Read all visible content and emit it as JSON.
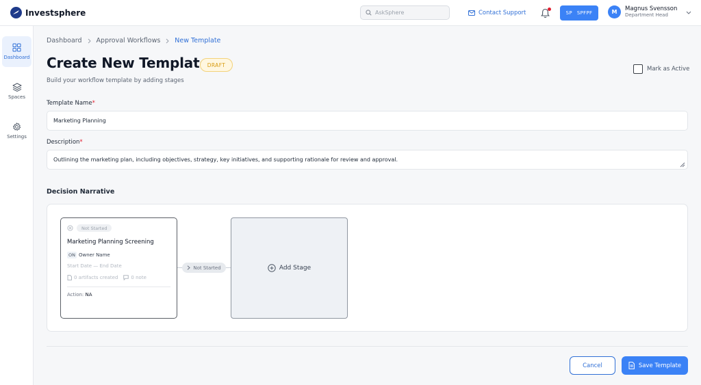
{
  "app": {
    "name": "Investsphere"
  },
  "header": {
    "search_placeholder": "AskSphere",
    "contact_label": "Contact Support",
    "space_initials": "SP",
    "space_name": "SPFPF",
    "user": {
      "initial": "M",
      "name": "Magnus Svensson",
      "role": "Department Head"
    }
  },
  "sidebar": {
    "items": [
      {
        "label": "Dashboard",
        "icon": "grid-icon",
        "active": true
      },
      {
        "label": "Spaces",
        "icon": "layers-icon",
        "active": false
      },
      {
        "label": "Settings",
        "icon": "gear-icon",
        "active": false
      }
    ]
  },
  "breadcrumb": {
    "items": [
      "Dashboard",
      "Approval Workflows",
      "New Template"
    ]
  },
  "page": {
    "title": "Create New Template",
    "badge": "DRAFT",
    "subtitle": "Build your workflow template by adding stages",
    "mark_active_label": "Mark as Active"
  },
  "form": {
    "template_name_label": "Template Name",
    "template_name_value": "Marketing Planning",
    "description_label": "Description",
    "description_value": "Outlining the marketing plan, including objectives, strategy, key initiatives, and supporting rationale for review and approval.",
    "required_mark": "*"
  },
  "narrative": {
    "title": "Decision Narrative",
    "stage": {
      "status": "Not Started",
      "name": "Marketing Planning Screening",
      "owner_prefix": "ON",
      "owner": "Owner Name",
      "dates": "Start Date — End Date",
      "artifacts": "0 artifacts created",
      "notes": "0 note",
      "action_label": "Action:",
      "action_value": "NA"
    },
    "connector_status": "Not Started",
    "add_stage_label": "Add Stage"
  },
  "footer": {
    "cancel_label": "Cancel",
    "save_label": "Save Template"
  },
  "colors": {
    "accent": "#3b82f6",
    "link": "#2f6fd6",
    "draft": "#d79a0e",
    "required": "#e11d2e"
  }
}
